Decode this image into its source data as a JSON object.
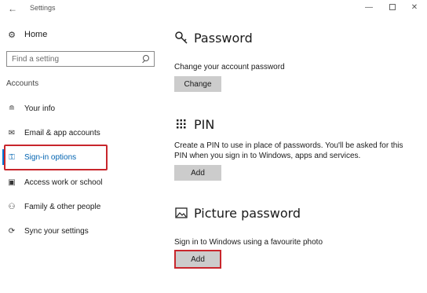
{
  "window": {
    "title": "Settings",
    "back_glyph": "←",
    "minimize_glyph": "—",
    "close_glyph": "✕"
  },
  "sidebar": {
    "home_label": "Home",
    "home_icon": "gear-icon",
    "search_placeholder": "Find a setting",
    "section_label": "Accounts",
    "items": [
      {
        "label": "Your info",
        "icon": "person-card-icon",
        "glyph": "≘"
      },
      {
        "label": "Email & app accounts",
        "icon": "mail-icon",
        "glyph": "✉"
      },
      {
        "label": "Sign-in options",
        "icon": "key-icon",
        "glyph": "⚿",
        "active": true
      },
      {
        "label": "Access work or school",
        "icon": "briefcase-icon",
        "glyph": "▣"
      },
      {
        "label": "Family & other people",
        "icon": "people-icon",
        "glyph": "⚇"
      },
      {
        "label": "Sync your settings",
        "icon": "sync-icon",
        "glyph": "⟳"
      }
    ]
  },
  "main": {
    "password": {
      "heading": "Password",
      "icon": "key-icon",
      "description": "Change your account password",
      "button_label": "Change"
    },
    "pin": {
      "heading": "PIN",
      "icon": "keypad-icon",
      "description_line1": "Create a PIN to use in place of passwords. You'll be asked for this",
      "description_line2": "PIN when you sign in to Windows, apps and services.",
      "button_label": "Add"
    },
    "picture_password": {
      "heading": "Picture password",
      "icon": "picture-icon",
      "description": "Sign in to Windows using a favourite photo",
      "button_label": "Add"
    }
  },
  "colors": {
    "accent": "#0078d7",
    "highlight_box": "#c8262c",
    "button_bg": "#cccccc"
  }
}
